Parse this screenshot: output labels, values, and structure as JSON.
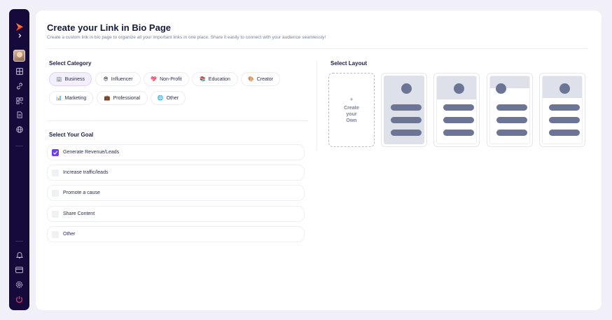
{
  "sidebar": {
    "icons": [
      "logo-icon",
      "chevron-right-icon",
      "grid-icon",
      "link-icon",
      "qr-code-icon",
      "document-icon",
      "globe-icon",
      "bell-icon",
      "credit-card-icon",
      "settings-icon",
      "power-icon"
    ],
    "accent_logo": "#ff4a2a",
    "power_color": "#ff2d6b"
  },
  "header": {
    "title": "Create your Link in Bio Page",
    "subtitle": "Create a custom link in bio page to organize all your important links in one place. Share it easily to connect with your audience seamlessly!"
  },
  "category": {
    "label": "Select Category",
    "items": [
      {
        "emoji": "🏢",
        "label": "Business",
        "active": true
      },
      {
        "emoji": "😎",
        "label": "Influencer",
        "active": false
      },
      {
        "emoji": "💖",
        "label": "Non-Profit",
        "active": false
      },
      {
        "emoji": "📚",
        "label": "Education",
        "active": false
      },
      {
        "emoji": "🎨",
        "label": "Creator",
        "active": false
      },
      {
        "emoji": "📊",
        "label": "Marketing",
        "active": false
      },
      {
        "emoji": "💼",
        "label": "Professional",
        "active": false
      },
      {
        "emoji": "🌐",
        "label": "Other",
        "active": false
      }
    ]
  },
  "goal": {
    "label": "Select Your Goal",
    "items": [
      {
        "label": "Generate Revenue/Leads",
        "checked": true
      },
      {
        "label": "Increase traffic/leads",
        "checked": false
      },
      {
        "label": "Promote a cause",
        "checked": false
      },
      {
        "label": "Share Content",
        "checked": false
      },
      {
        "label": "Other",
        "checked": false
      }
    ]
  },
  "layout": {
    "label": "Select Layout",
    "create_plus": "+",
    "create_label": "Create your Own",
    "templates": [
      "full-background",
      "top-banner",
      "left-avatar-banner",
      "top-banner-centered"
    ]
  },
  "colors": {
    "accent": "#6d3ff0",
    "sidebar_bg": "#160a3a",
    "placeholder": "#6c7596"
  }
}
